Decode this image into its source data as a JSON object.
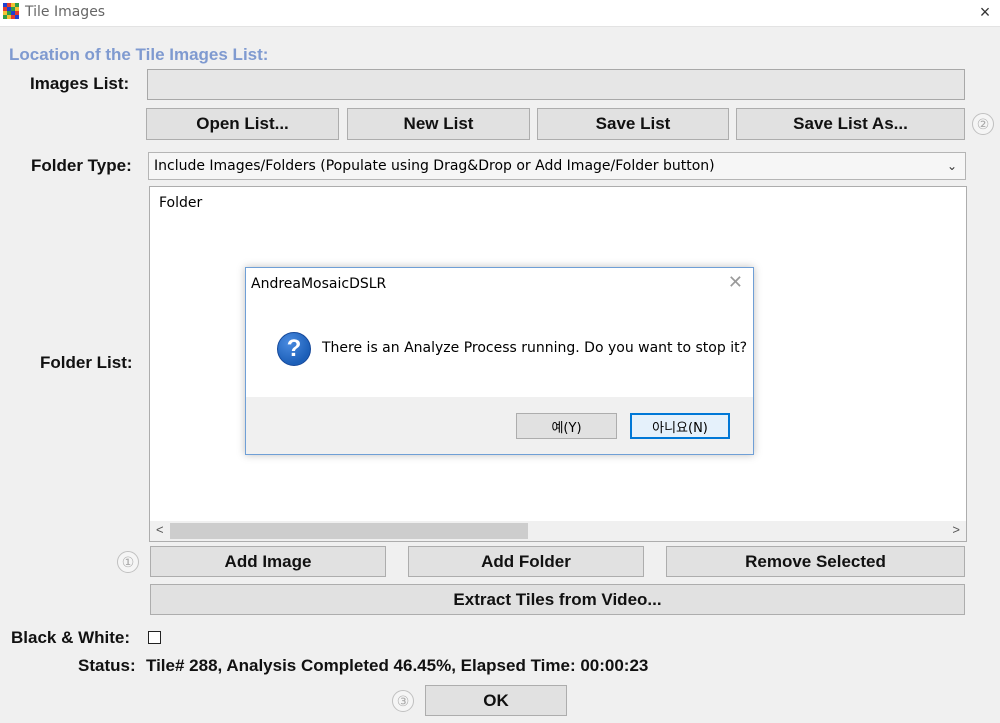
{
  "window": {
    "title": "Tile Images",
    "close_icon": "×",
    "icon_colors": [
      "#1f3fd0",
      "#e23b2e",
      "#f1c232",
      "#2f9e44",
      "#e23b2e",
      "#1f3fd0",
      "#2f9e44",
      "#f1c232",
      "#f1c232",
      "#2f9e44",
      "#1f3fd0",
      "#e23b2e",
      "#2f9e44",
      "#f1c232",
      "#e23b2e",
      "#1f3fd0"
    ]
  },
  "section_title": "Location of the Tile Images List:",
  "images_list": {
    "label": "Images List:",
    "value": ""
  },
  "list_buttons": {
    "open": "Open List...",
    "new": "New List",
    "save": "Save List",
    "save_as": "Save List As...",
    "help_badge": "②"
  },
  "folder_type": {
    "label": "Folder Type:",
    "selected": "Include Images/Folders (Populate using Drag&Drop or Add Image/Folder button)",
    "chevron": "⌄"
  },
  "folder_list": {
    "label": "Folder List:",
    "items": [
      "Folder"
    ],
    "scroll_left": "<",
    "scroll_right": ">"
  },
  "folder_buttons": {
    "help_badge": "①",
    "add_image": "Add Image",
    "add_folder": "Add Folder",
    "remove_selected": "Remove Selected",
    "extract": "Extract Tiles from Video..."
  },
  "black_white": {
    "label": "Black & White:",
    "checked": false
  },
  "status": {
    "label": "Status:",
    "text": "Tile# 288, Analysis Completed 46.45%, Elapsed Time: 00:00:23"
  },
  "ok": {
    "help_badge": "③",
    "label": "OK"
  },
  "dialog": {
    "title": "AndreaMosaicDSLR",
    "close_icon": "✕",
    "icon": "?",
    "message": "There is an Analyze Process running. Do you want to stop it?",
    "yes": "예(Y)",
    "no": "아니요(N)"
  },
  "colors": {
    "section_title": "#7f9ad0",
    "dialog_border": "#6f9fd6",
    "default_button_border": "#0078d7"
  }
}
